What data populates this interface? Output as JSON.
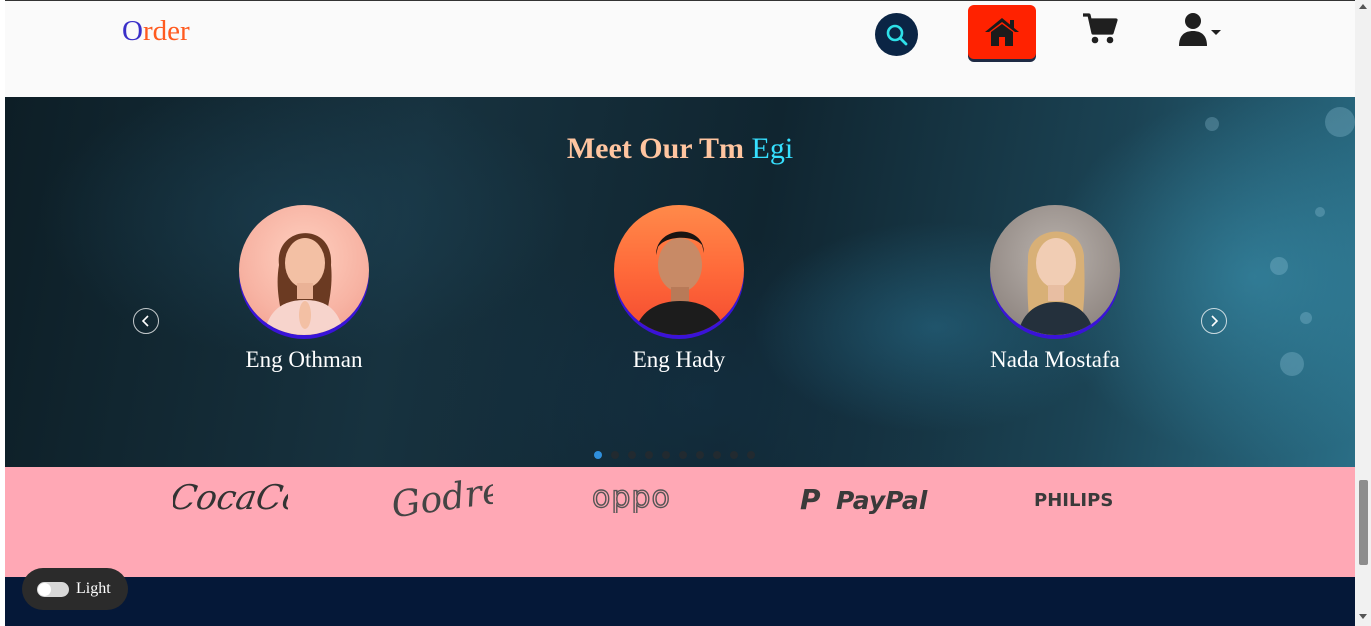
{
  "navbar": {
    "brand_part1": "O",
    "brand_part2": "rder",
    "icons": [
      "search-icon",
      "home-icon",
      "cart-icon",
      "user-icon"
    ]
  },
  "hero": {
    "title_part1": "Meet Our Tm ",
    "title_part2": "Egi",
    "members": [
      {
        "name": "Eng Othman"
      },
      {
        "name": "Eng Hady"
      },
      {
        "name": "Nada Mostafa"
      }
    ],
    "carousel_dots": 10,
    "active_dot": 0
  },
  "brands": {
    "logos": [
      "Coca-Cola",
      "Godrej",
      "oppo",
      "PayPal",
      "PHILIPS"
    ]
  },
  "theme_toggle": {
    "label": "Light"
  },
  "colors": {
    "brand_blue": "#3a2fc8",
    "brand_orange": "#ff5a1f",
    "home_red": "#ff2200",
    "brands_bg": "#ffa8b5",
    "footer_bg": "#051838",
    "title_peach": "#ffc5a0",
    "title_cyan": "#36e0ff"
  }
}
